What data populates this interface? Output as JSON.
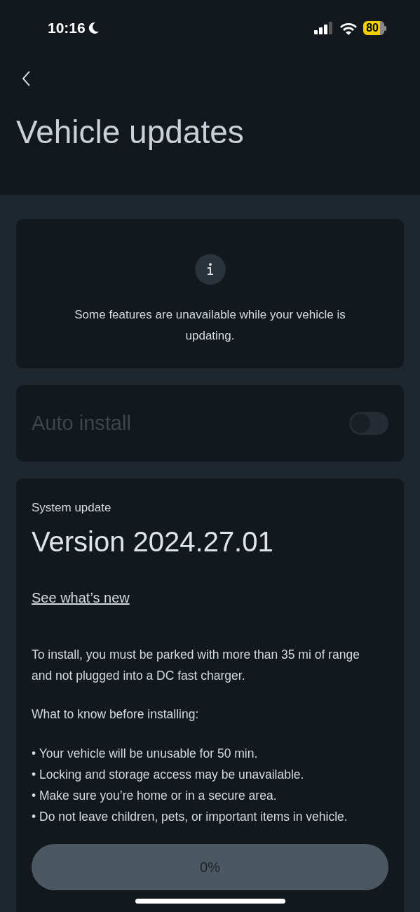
{
  "status_bar": {
    "time": "10:16",
    "battery": "80"
  },
  "header": {
    "title": "Vehicle updates"
  },
  "notice": {
    "text": "Some features are unavailable while your vehicle is updating."
  },
  "auto_install": {
    "label": "Auto install",
    "on": false,
    "disabled": true
  },
  "update": {
    "label": "System update",
    "version": "Version 2024.27.01",
    "link": "See what’s new",
    "requirement": "To install, you must be parked with more than 35 mi of range and not plugged into a DC fast charger.",
    "list_title": "What to know before installing:",
    "items": [
      "• Your vehicle will be unusable for 50 min.",
      "• Locking and storage access may be unavailable.",
      "• Make sure you’re home or in a secure area.",
      "• Do not leave children, pets, or important items in vehicle."
    ],
    "progress": {
      "level": 0,
      "reading": "0%"
    }
  }
}
